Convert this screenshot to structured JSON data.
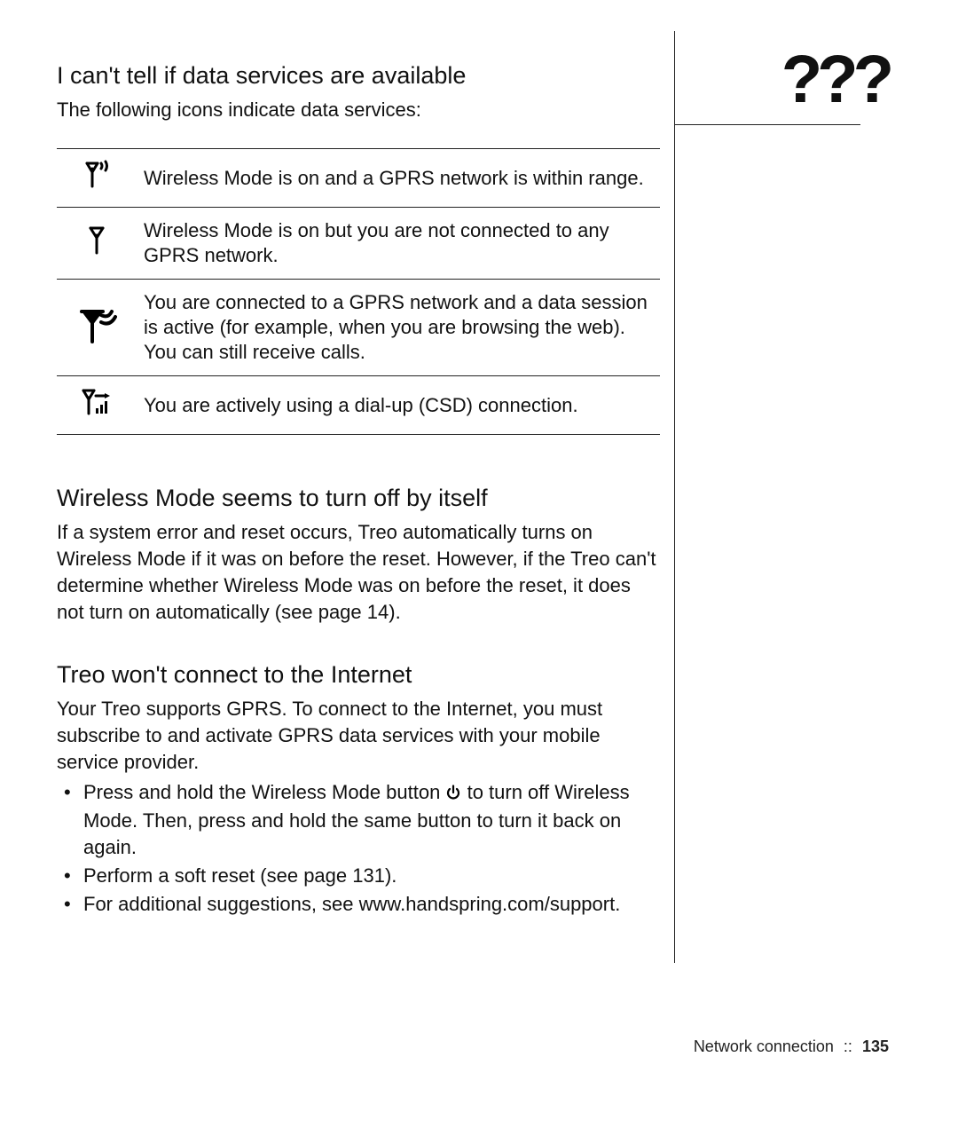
{
  "qmarks": "???",
  "section1": {
    "heading": "I can't tell if data services are available",
    "lead": "The following icons indicate data services:"
  },
  "icons": [
    {
      "desc": "Wireless Mode is on and a GPRS network is within range."
    },
    {
      "desc": "Wireless Mode is on but you are not connected to any GPRS network."
    },
    {
      "desc": "You are connected to a GPRS network and a data session is active (for example, when you are browsing the web). You can still receive calls."
    },
    {
      "desc": "You are actively using a dial-up (CSD) connection."
    }
  ],
  "section2": {
    "heading": "Wireless Mode seems to turn off by itself",
    "body": "If a system error and reset occurs, Treo automatically turns on Wireless Mode if it was on before the reset. However, if the Treo can't determine whether Wireless Mode was on before the reset, it does not turn on automatically (see page 14)."
  },
  "section3": {
    "heading": "Treo won't connect to the Internet",
    "lead": "Your Treo supports GPRS. To connect to the Internet, you must subscribe to and activate GPRS data services with your mobile service provider.",
    "bullets": {
      "b1_pre": "Press and hold the Wireless Mode button ",
      "b1_post": " to turn off Wireless Mode. Then, press and hold the same button to turn it back on again.",
      "b2": "Perform a soft reset (see page 131).",
      "b3": "For additional suggestions, see www.handspring.com/support."
    }
  },
  "footer": {
    "section_name": "Network connection",
    "sep": "::",
    "page": "135"
  }
}
